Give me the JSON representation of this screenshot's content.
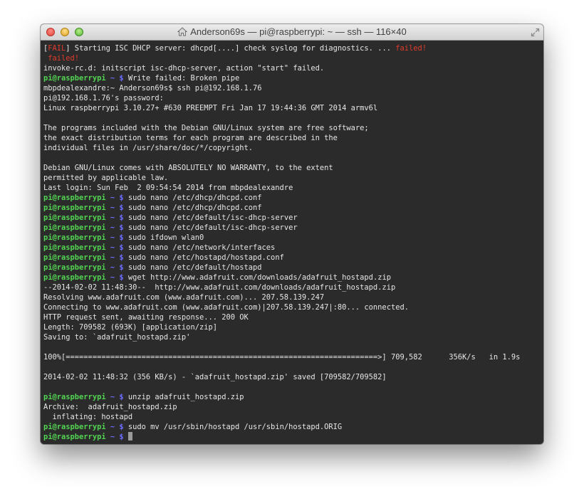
{
  "window": {
    "title": "Anderson69s — pi@raspberrypi: ~ — ssh — 116×40"
  },
  "colors": {
    "prompt_user": "#52d452",
    "prompt_tail": "#6c6cff",
    "error": "#e03c2c",
    "terminal_bg": "#2b2b2b",
    "text": "#e6e6e6"
  },
  "terminal": {
    "prompt_user": "pi@raspberrypi",
    "prompt_tail": " ~ $ ",
    "lines": [
      {
        "type": "fail",
        "pre": "[",
        "fail": "FAIL",
        "mid": "] Starting ISC DHCP server: dhcpd[....] check syslog for diagnostics. ... ",
        "tail": "failed!"
      },
      {
        "type": "red",
        "text": " failed!"
      },
      {
        "type": "out",
        "text": "invoke-rc.d: initscript isc-dhcp-server, action \"start\" failed."
      },
      {
        "type": "cmd",
        "text": "Write failed: Broken pipe"
      },
      {
        "type": "out",
        "text": "mbpdealexandre:~ Anderson69s$ ssh pi@192.168.1.76"
      },
      {
        "type": "out",
        "text": "pi@192.168.1.76's password:"
      },
      {
        "type": "out",
        "text": "Linux raspberrypi 3.10.27+ #630 PREEMPT Fri Jan 17 19:44:36 GMT 2014 armv6l"
      },
      {
        "type": "out",
        "text": ""
      },
      {
        "type": "out",
        "text": "The programs included with the Debian GNU/Linux system are free software;"
      },
      {
        "type": "out",
        "text": "the exact distribution terms for each program are described in the"
      },
      {
        "type": "out",
        "text": "individual files in /usr/share/doc/*/copyright."
      },
      {
        "type": "out",
        "text": ""
      },
      {
        "type": "out",
        "text": "Debian GNU/Linux comes with ABSOLUTELY NO WARRANTY, to the extent"
      },
      {
        "type": "out",
        "text": "permitted by applicable law."
      },
      {
        "type": "out",
        "text": "Last login: Sun Feb  2 09:54:54 2014 from mbpdealexandre"
      },
      {
        "type": "cmd",
        "text": "sudo nano /etc/dhcp/dhcpd.conf"
      },
      {
        "type": "cmd",
        "text": "sudo nano /etc/dhcp/dhcpd.conf"
      },
      {
        "type": "cmd",
        "text": "sudo nano /etc/default/isc-dhcp-server"
      },
      {
        "type": "cmd",
        "text": "sudo nano /etc/default/isc-dhcp-server"
      },
      {
        "type": "cmd",
        "text": "sudo ifdown wlan0"
      },
      {
        "type": "cmd",
        "text": "sudo nano /etc/network/interfaces"
      },
      {
        "type": "cmd",
        "text": "sudo nano /etc/hostapd/hostapd.conf"
      },
      {
        "type": "cmd",
        "text": "sudo nano /etc/default/hostapd"
      },
      {
        "type": "cmd",
        "text": "wget http://www.adafruit.com/downloads/adafruit_hostapd.zip"
      },
      {
        "type": "out",
        "text": "--2014-02-02 11:48:30--  http://www.adafruit.com/downloads/adafruit_hostapd.zip"
      },
      {
        "type": "out",
        "text": "Resolving www.adafruit.com (www.adafruit.com)... 207.58.139.247"
      },
      {
        "type": "out",
        "text": "Connecting to www.adafruit.com (www.adafruit.com)|207.58.139.247|:80... connected."
      },
      {
        "type": "out",
        "text": "HTTP request sent, awaiting response... 200 OK"
      },
      {
        "type": "out",
        "text": "Length: 709582 (693K) [application/zip]"
      },
      {
        "type": "out",
        "text": "Saving to: `adafruit_hostapd.zip'"
      },
      {
        "type": "out",
        "text": ""
      },
      {
        "type": "out",
        "text": "100%[======================================================================>] 709,582      356K/s   in 1.9s"
      },
      {
        "type": "out",
        "text": ""
      },
      {
        "type": "out",
        "text": "2014-02-02 11:48:32 (356 KB/s) - `adafruit_hostapd.zip' saved [709582/709582]"
      },
      {
        "type": "out",
        "text": ""
      },
      {
        "type": "cmd",
        "text": "unzip adafruit_hostapd.zip"
      },
      {
        "type": "out",
        "text": "Archive:  adafruit_hostapd.zip"
      },
      {
        "type": "out",
        "text": "  inflating: hostapd"
      },
      {
        "type": "cmd",
        "text": "sudo mv /usr/sbin/hostapd /usr/sbin/hostapd.ORIG"
      },
      {
        "type": "cmd_cursor",
        "text": ""
      }
    ]
  }
}
